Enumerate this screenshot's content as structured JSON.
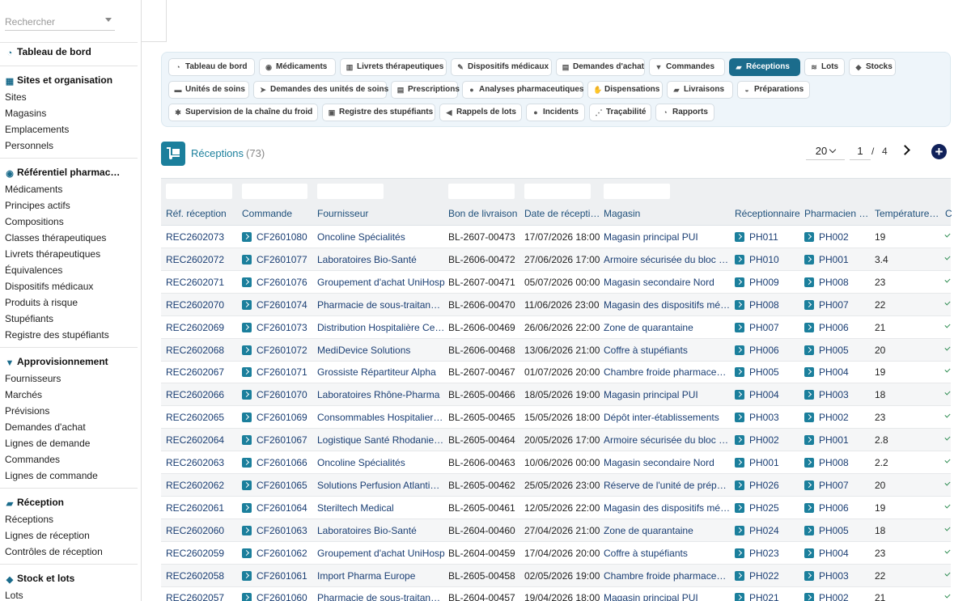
{
  "sidebar": {
    "search_placeholder": "Rechercher",
    "dashboard": "Tableau de bord",
    "sections": [
      {
        "title": "Sites et organisation",
        "icon": "building-icon",
        "items": [
          "Sites",
          "Magasins",
          "Emplacements",
          "Personnels"
        ]
      },
      {
        "title": "Référentiel pharmac…",
        "icon": "pills-icon",
        "items": [
          "Médicaments",
          "Principes actifs",
          "Compositions",
          "Classes thérapeutiques",
          "Livrets thérapeutiques",
          "Équivalences",
          "Dispositifs médicaux",
          "Produits à risque",
          "Stupéfiants",
          "Registre des stupéfiants"
        ]
      },
      {
        "title": "Approvisionnement",
        "icon": "cart-icon",
        "items": [
          "Fournisseurs",
          "Marchés",
          "Prévisions",
          "Demandes d'achat",
          "Lignes de demande",
          "Commandes",
          "Lignes de commande"
        ]
      },
      {
        "title": "Réception",
        "icon": "dolly-icon",
        "items": [
          "Réceptions",
          "Lignes de réception",
          "Contrôles de réception"
        ]
      },
      {
        "title": "Stock et lots",
        "icon": "cubes-icon",
        "items": [
          "Lots"
        ]
      }
    ]
  },
  "nav": {
    "rows": [
      [
        "Tableau de bord",
        "Médicaments",
        "Livrets thérapeutiques",
        "Dispositifs médicaux",
        "Demandes d'achat",
        "Commandes",
        "Réceptions",
        "Lots",
        "Stocks"
      ],
      [
        "Unités de soins",
        "Demandes des unités de soins",
        "Prescriptions",
        "Analyses pharmaceutiques",
        "Dispensations",
        "Livraisons",
        "Préparations"
      ],
      [
        "Supervision de la chaîne du froid",
        "Registre des stupéfiants",
        "Rappels de lots",
        "Incidents",
        "Traçabilité",
        "Rapports"
      ]
    ],
    "active": "Réceptions"
  },
  "page": {
    "title": "Réceptions",
    "count": "(73)",
    "page_size": "20",
    "current_page": "1",
    "separator": "/",
    "total_pages": "4"
  },
  "table": {
    "columns": [
      "Réf. réception",
      "Commande",
      "Fournisseur",
      "Bon de livraison",
      "Date de récepti…",
      "Magasin",
      "Réceptionnaire",
      "Pharmacien …",
      "Température…",
      "C"
    ],
    "rows": [
      [
        "REC2602073",
        "CF2601080",
        "Oncoline Spécialités",
        "BL-2607-00473",
        "17/07/2026 18:00",
        "Magasin principal PUI",
        "PH011",
        "PH002",
        "19"
      ],
      [
        "REC2602072",
        "CF2601077",
        "Laboratoires Bio-Santé",
        "BL-2606-00472",
        "27/06/2026 17:00",
        "Armoire sécurisée du bloc o…",
        "PH010",
        "PH001",
        "3.4"
      ],
      [
        "REC2602071",
        "CF2601076",
        "Groupement d'achat UniHosp",
        "BL-2607-00471",
        "05/07/2026 00:00",
        "Magasin secondaire Nord",
        "PH009",
        "PH008",
        "23"
      ],
      [
        "REC2602070",
        "CF2601074",
        "Pharmacie de sous-traitanc…",
        "BL-2606-00470",
        "11/06/2026 23:00",
        "Magasin des dispositifs méd…",
        "PH008",
        "PH007",
        "22"
      ],
      [
        "REC2602069",
        "CF2601073",
        "Distribution Hospitalière Ce…",
        "BL-2606-00469",
        "26/06/2026 22:00",
        "Zone de quarantaine",
        "PH007",
        "PH006",
        "21"
      ],
      [
        "REC2602068",
        "CF2601072",
        "MediDevice Solutions",
        "BL-2606-00468",
        "13/06/2026 21:00",
        "Coffre à stupéfiants",
        "PH006",
        "PH005",
        "20"
      ],
      [
        "REC2602067",
        "CF2601071",
        "Grossiste Répartiteur Alpha",
        "BL-2607-00467",
        "01/07/2026 20:00",
        "Chambre froide pharmaceut…",
        "PH005",
        "PH004",
        "19"
      ],
      [
        "REC2602066",
        "CF2601070",
        "Laboratoires Rhône-Pharma",
        "BL-2605-00466",
        "18/05/2026 19:00",
        "Magasin principal PUI",
        "PH004",
        "PH003",
        "18"
      ],
      [
        "REC2602065",
        "CF2601069",
        "Consommables Hospitaliers…",
        "BL-2605-00465",
        "15/05/2026 18:00",
        "Dépôt inter-établissements",
        "PH003",
        "PH002",
        "23"
      ],
      [
        "REC2602064",
        "CF2601067",
        "Logistique Santé Rhodanien…",
        "BL-2605-00464",
        "20/05/2026 17:00",
        "Armoire sécurisée du bloc o…",
        "PH002",
        "PH001",
        "2.8"
      ],
      [
        "REC2602063",
        "CF2601066",
        "Oncoline Spécialités",
        "BL-2606-00463",
        "10/06/2026 00:00",
        "Magasin secondaire Nord",
        "PH001",
        "PH008",
        "2.2"
      ],
      [
        "REC2602062",
        "CF2601065",
        "Solutions Perfusion Atlantique",
        "BL-2605-00462",
        "25/05/2026 23:00",
        "Réserve de l'unité de prépar…",
        "PH026",
        "PH007",
        "20"
      ],
      [
        "REC2602061",
        "CF2601064",
        "Steriltech Medical",
        "BL-2605-00461",
        "12/05/2026 22:00",
        "Magasin des dispositifs méd…",
        "PH025",
        "PH006",
        "19"
      ],
      [
        "REC2602060",
        "CF2601063",
        "Laboratoires Bio-Santé",
        "BL-2604-00460",
        "27/04/2026 21:00",
        "Zone de quarantaine",
        "PH024",
        "PH005",
        "18"
      ],
      [
        "REC2602059",
        "CF2601062",
        "Groupement d'achat UniHosp",
        "BL-2604-00459",
        "17/04/2026 20:00",
        "Coffre à stupéfiants",
        "PH023",
        "PH004",
        "23"
      ],
      [
        "REC2602058",
        "CF2601061",
        "Import Pharma Europe",
        "BL-2605-00458",
        "02/05/2026 19:00",
        "Chambre froide pharmaceut…",
        "PH022",
        "PH003",
        "22"
      ],
      [
        "REC2602057",
        "CF2601060",
        "Pharmacie de sous-traitanc…",
        "BL-2604-00457",
        "19/04/2026 18:00",
        "Magasin principal PUI",
        "PH021",
        "PH002",
        "21"
      ]
    ]
  }
}
